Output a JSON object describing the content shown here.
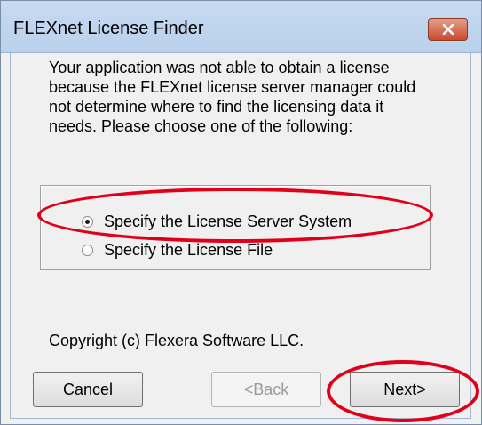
{
  "window": {
    "title": "FLEXnet License Finder"
  },
  "dialog": {
    "message": "Your application was not able to obtain a license because the FLEXnet license server manager could not determine where to find the licensing data it needs.  Please choose one of the following:",
    "options": [
      {
        "label": "Specify the License Server System",
        "selected": true
      },
      {
        "label": "Specify the License File",
        "selected": false
      }
    ],
    "copyright": "Copyright (c) Flexera Software LLC."
  },
  "buttons": {
    "cancel_label": "Cancel",
    "back_label": "<Back",
    "next_label": "Next>"
  },
  "colors": {
    "annotation": "#e0001a",
    "close_button": "#c94b2f"
  },
  "icons": {
    "close": "close-icon"
  }
}
